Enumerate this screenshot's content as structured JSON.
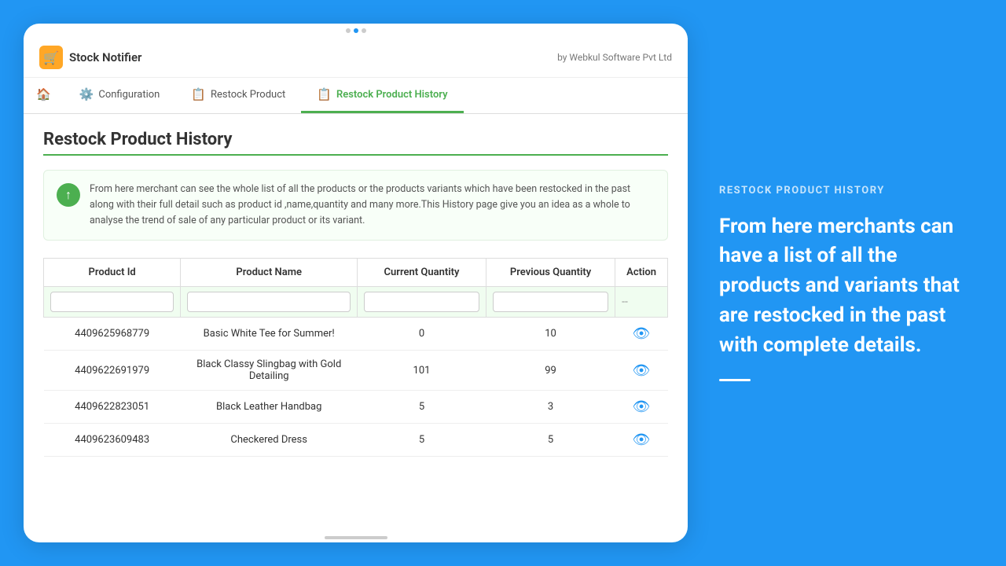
{
  "app": {
    "title": "Stock Notifier",
    "by_text": "by Webkul Software Pvt Ltd",
    "icon": "🛒"
  },
  "nav": {
    "tabs": [
      {
        "id": "home",
        "label": "",
        "icon": "🏠",
        "active": false
      },
      {
        "id": "configuration",
        "label": "Configuration",
        "icon": "⚙️",
        "active": false
      },
      {
        "id": "restock-product",
        "label": "Restock Product",
        "icon": "📋",
        "active": false
      },
      {
        "id": "restock-product-history",
        "label": "Restock Product History",
        "icon": "📋",
        "active": true
      }
    ]
  },
  "page": {
    "title": "Restock Product History",
    "info_text": "From here merchant can see the whole list of all the products or the products variants which have been restocked in the past along with their full detail such as product id ,name,quantity and many more.This History page give you an idea as a whole to analyse the trend of sale of any particular product or its variant."
  },
  "table": {
    "columns": [
      "Product Id",
      "Product Name",
      "Current Quantity",
      "Previous Quantity",
      "Action"
    ],
    "filter_placeholder": [
      "",
      "",
      "",
      "",
      "--"
    ],
    "rows": [
      {
        "product_id": "4409625968779",
        "product_name": "Basic White Tee for Summer!",
        "current_qty": "0",
        "previous_qty": "10",
        "has_action": true
      },
      {
        "product_id": "4409622691979",
        "product_name": "Black Classy Slingbag with Gold Detailing",
        "current_qty": "101",
        "previous_qty": "99",
        "has_action": true
      },
      {
        "product_id": "4409622823051",
        "product_name": "Black Leather Handbag",
        "current_qty": "5",
        "previous_qty": "3",
        "has_action": true
      },
      {
        "product_id": "4409623609483",
        "product_name": "Checkered Dress",
        "current_qty": "5",
        "previous_qty": "5",
        "has_action": true
      }
    ]
  },
  "right_panel": {
    "label": "RESTOCK PRODUCT HISTORY",
    "description": "From here merchants can have a list of all the products and variants that are restocked in the past with complete details."
  }
}
